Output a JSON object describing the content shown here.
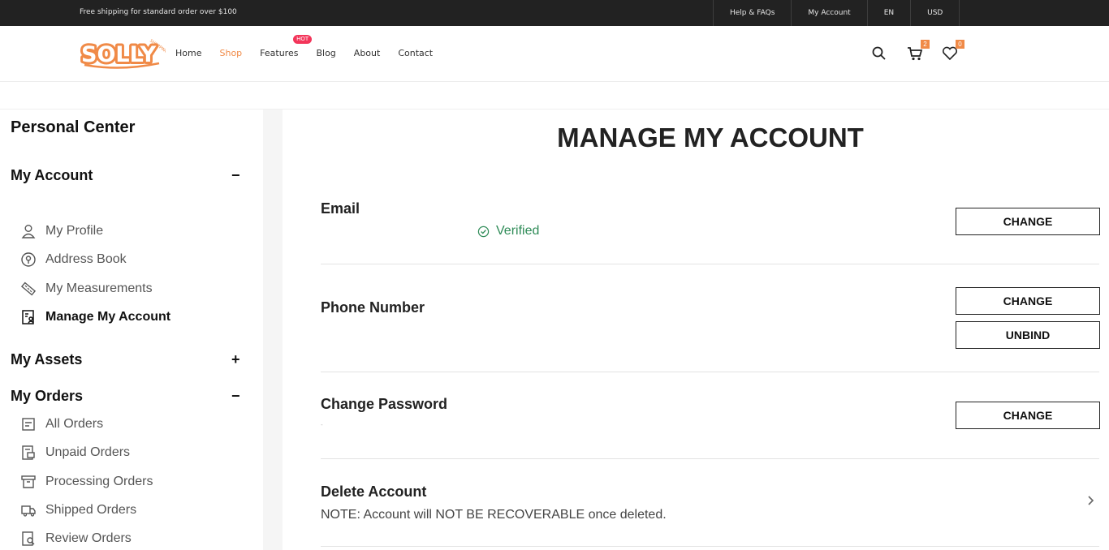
{
  "topbar": {
    "promo": "Free shipping for standard order over $100",
    "links": [
      "Help & FAQs",
      "My Account",
      "EN",
      "USD"
    ]
  },
  "header": {
    "logo_text": "SOLLY",
    "logo_subtext": "SHOPPING",
    "nav": [
      "Home",
      "Shop",
      "Features",
      "Blog",
      "About",
      "Contact"
    ],
    "active_nav": "Shop",
    "hot_badge": "HOT",
    "cart_count": "2",
    "wishlist_count": "0",
    "accent": "#f08a47"
  },
  "sidebar": {
    "title": "Personal Center",
    "my_account": {
      "label": "My Account",
      "toggle": "−",
      "items": [
        {
          "label": "My Profile",
          "icon": "user-icon"
        },
        {
          "label": "Address Book",
          "icon": "location-pin-icon"
        },
        {
          "label": "My Measurements",
          "icon": "ruler-icon"
        },
        {
          "label": "Manage My Account",
          "icon": "account-settings-icon",
          "active": true
        }
      ]
    },
    "my_assets": {
      "label": "My Assets",
      "toggle": "+"
    },
    "my_orders": {
      "label": "My Orders",
      "toggle": "−",
      "items": [
        {
          "label": "All Orders",
          "icon": "orders-icon"
        },
        {
          "label": "Unpaid Orders",
          "icon": "unpaid-icon"
        },
        {
          "label": "Processing Orders",
          "icon": "processing-icon"
        },
        {
          "label": "Shipped Orders",
          "icon": "truck-icon"
        },
        {
          "label": "Review Orders",
          "icon": "review-icon"
        }
      ]
    }
  },
  "main": {
    "title": "MANAGE MY ACCOUNT",
    "email": {
      "label": "Email",
      "status": "Verified",
      "button": "CHANGE"
    },
    "phone": {
      "label": "Phone Number",
      "change_button": "CHANGE",
      "unbind_button": "UNBIND"
    },
    "password": {
      "label": "Change Password",
      "button": "CHANGE",
      "hint": "-"
    },
    "delete": {
      "label": "Delete Account",
      "note": "NOTE: Account will NOT BE RECOVERABLE once deleted."
    }
  }
}
